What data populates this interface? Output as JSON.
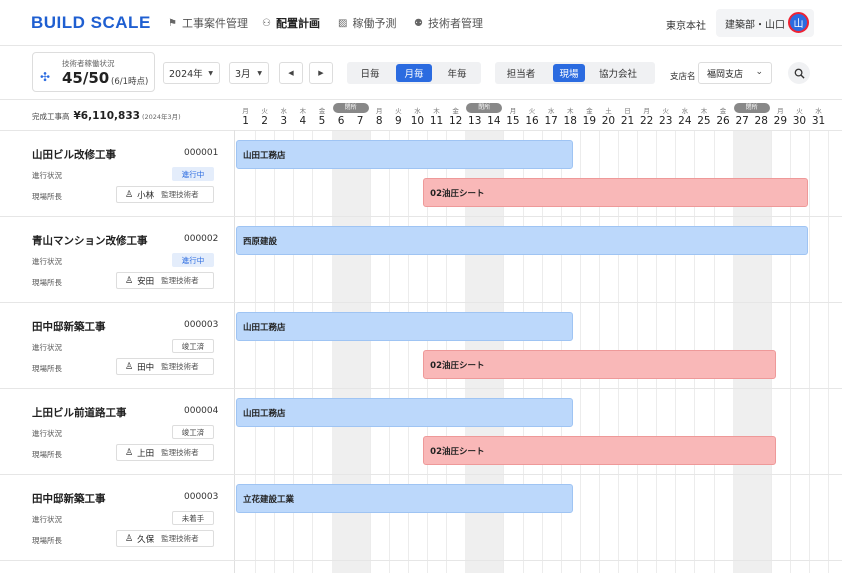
{
  "header": {
    "logo": "BUILD SCALE",
    "nav": [
      {
        "label": "工事案件管理",
        "icon": "flag-icon"
      },
      {
        "label": "配置計画",
        "icon": "people-icon",
        "active": true
      },
      {
        "label": "稼働予測",
        "icon": "chart-icon"
      },
      {
        "label": "技術者管理",
        "icon": "team-icon"
      }
    ],
    "org": "東京本社",
    "user_label": "建築部・山口",
    "avatar": "山"
  },
  "toolbar": {
    "stat_label": "技術者稼働状況",
    "stat_value": "45/50",
    "stat_note": "(6/1時点)",
    "year": "2024年",
    "month": "3月",
    "prev": "◀",
    "next": "▶",
    "views": [
      "日毎",
      "月毎",
      "年毎"
    ],
    "active_view": "月毎",
    "groupings": [
      "担当者",
      "現場",
      "協力会社"
    ],
    "active_grouping": "現場",
    "branch_label": "支店名",
    "branch_value": "福岡支店"
  },
  "calendar": {
    "totals_label": "完成工事高",
    "totals_value": "¥6,110,833",
    "totals_note": "(2024年3月)",
    "closed_label": "閉所",
    "days": [
      {
        "d": "1",
        "w": "月"
      },
      {
        "d": "2",
        "w": "火"
      },
      {
        "d": "3",
        "w": "水"
      },
      {
        "d": "4",
        "w": "木"
      },
      {
        "d": "5",
        "w": "金"
      },
      {
        "d": "6",
        "w": "土",
        "closed": true
      },
      {
        "d": "7",
        "w": "日",
        "closed": true
      },
      {
        "d": "8",
        "w": "月"
      },
      {
        "d": "9",
        "w": "火"
      },
      {
        "d": "10",
        "w": "水"
      },
      {
        "d": "11",
        "w": "木"
      },
      {
        "d": "12",
        "w": "金"
      },
      {
        "d": "13",
        "w": "土",
        "closed": true
      },
      {
        "d": "14",
        "w": "日",
        "closed": true
      },
      {
        "d": "15",
        "w": "月"
      },
      {
        "d": "16",
        "w": "火"
      },
      {
        "d": "17",
        "w": "水"
      },
      {
        "d": "18",
        "w": "木"
      },
      {
        "d": "19",
        "w": "金"
      },
      {
        "d": "20",
        "w": "土"
      },
      {
        "d": "21",
        "w": "日"
      },
      {
        "d": "22",
        "w": "月"
      },
      {
        "d": "23",
        "w": "火"
      },
      {
        "d": "24",
        "w": "水"
      },
      {
        "d": "25",
        "w": "木"
      },
      {
        "d": "26",
        "w": "金"
      },
      {
        "d": "27",
        "w": "土",
        "closed": true
      },
      {
        "d": "28",
        "w": "日",
        "closed": true
      },
      {
        "d": "29",
        "w": "月"
      },
      {
        "d": "30",
        "w": "火"
      },
      {
        "d": "31",
        "w": "水"
      }
    ]
  },
  "labels": {
    "status": "進行状況",
    "manager": "現場所長",
    "role": "監理技術者"
  },
  "projects": [
    {
      "name": "山田ビル改修工事",
      "code": "000001",
      "status": "進行中",
      "status_type": "active",
      "manager": "小林",
      "bars": [
        {
          "label": "山田工務店",
          "color": "blue",
          "start": 1,
          "end": 17.7
        },
        {
          "label": "02油圧シート",
          "color": "pink",
          "start": 10.8,
          "end": 31
        }
      ]
    },
    {
      "name": "青山マンション改修工事",
      "code": "000002",
      "status": "進行中",
      "status_type": "active",
      "manager": "安田",
      "bars": [
        {
          "label": "西原建設",
          "color": "blue",
          "start": 1,
          "end": 31
        }
      ]
    },
    {
      "name": "田中邸新築工事",
      "code": "000003",
      "status": "竣工済",
      "status_type": "done",
      "manager": "田中",
      "bars": [
        {
          "label": "山田工務店",
          "color": "blue",
          "start": 1,
          "end": 17.7
        },
        {
          "label": "02油圧シート",
          "color": "pink",
          "start": 10.8,
          "end": 28.3
        }
      ]
    },
    {
      "name": "上田ビル前道路工事",
      "code": "000004",
      "status": "竣工済",
      "status_type": "done",
      "manager": "上田",
      "bars": [
        {
          "label": "山田工務店",
          "color": "blue",
          "start": 1,
          "end": 17.7
        },
        {
          "label": "02油圧シート",
          "color": "pink",
          "start": 10.8,
          "end": 28.3
        }
      ]
    },
    {
      "name": "田中邸新築工事",
      "code": "000003",
      "status": "未着手",
      "status_type": "done",
      "manager": "久保",
      "bars": [
        {
          "label": "立花建設工業",
          "color": "blue",
          "start": 1,
          "end": 17.7
        }
      ]
    }
  ]
}
